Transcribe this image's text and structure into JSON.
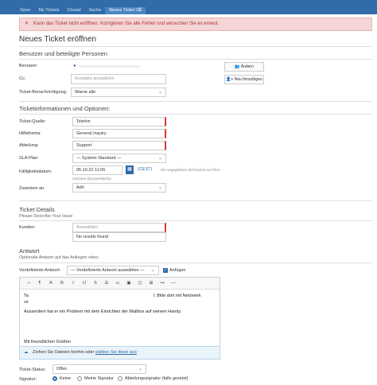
{
  "nav": {
    "tabs": [
      "Open",
      "My Tickets",
      "Closed",
      "Suche",
      "Neues Ticket"
    ],
    "active_icon": "eraser-icon"
  },
  "alert": {
    "text": "Kann das Ticket nicht eröffnen. Korrigieren Sie alle Fehler und versuchen Sie es erneut.",
    "icon": "close-icon"
  },
  "title": "Neues Ticket eröffnen",
  "section_user": "Benutzer und beteiligte Personen",
  "user": {
    "benutzer_label": "Benutzer:",
    "benutzer_icon": "person-icon",
    "cc_label": "Cc:",
    "cc_placeholder": "Kontakte auswählen",
    "notify_label": "Ticket-Benachrichtigung:",
    "notify_value": "Warne alle",
    "change_button": "Ändern",
    "add_new_button": "Neu hinzufügen"
  },
  "section_ticket": "Ticketinformationen und Optionen:",
  "ticket": {
    "source_label": "Ticket-Quelle:",
    "source_value": "Telefon",
    "topic_label": "Hilfethema:",
    "topic_value": "General Inquiry",
    "dept_label": "Abteilung:",
    "dept_value": "Support",
    "sla_label": "SLA-Plan:",
    "sla_value": "— System-Standard —",
    "due_label": "Fälligkeitsdatum:",
    "due_value": "05.10.22 11:06",
    "tz": "(CEST)",
    "due_hint": "Die angegebene Zeit basiert auf Ihrer",
    "zone_hint": "Zeitzone (Europe/Berlin)",
    "assign_label": "Zuweisen an:",
    "assign_value": "Adri"
  },
  "section_details": "Ticket Details",
  "details_sub": "Please Describe Your Issue",
  "details": {
    "kunden_label": "Kunden:",
    "kunden_placeholder": "Auswählen",
    "no_results": "No results found"
  },
  "section_answer": "Antwort",
  "answer_sub": "Optionale Antwort auf das Anliegen oben.",
  "answer": {
    "canned_label": "Vordefinierte Antwort:",
    "canned_value": "— Vordefinierte Antwort auswählen —",
    "attach_label": "Anfügen",
    "line1a": "Ta",
    "line1b": "l. Bitte dort mit Netzwerk",
    "line2": "ve",
    "line3": "Ausserdem hat er ein Problem mit dem Einrichten der Mailbox auf seinem Handy.",
    "greeting": "Mit freundlichen Grüßen",
    "drop_text": "Ziehen Sie Dateien hierhin oder ",
    "drop_link": "wählen Sie diese aus"
  },
  "toolbar": [
    "‹›",
    "¶",
    "A",
    "B",
    "I",
    "U",
    "S",
    "☰",
    "▭",
    "▣",
    "◫",
    "⊞",
    "⊶",
    "—"
  ],
  "status": {
    "label": "Ticket-Status:",
    "value": "Offen",
    "sig_label": "Signatur:",
    "sig_options": [
      "Keine",
      "Meine Signatur",
      "Abteilungssignatur (falls gesetzt)"
    ]
  }
}
